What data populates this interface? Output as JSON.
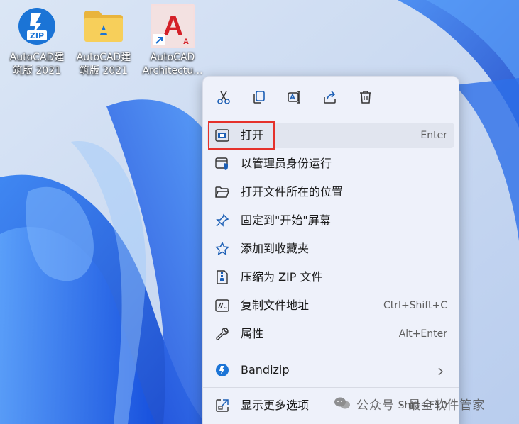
{
  "desktop": {
    "icons": [
      {
        "label_line1": "AutoCAD建",
        "label_line2": "筑版 2021",
        "icon": "zip-archive-icon",
        "badge": "ZIP"
      },
      {
        "label_line1": "AutoCAD建",
        "label_line2": "筑版 2021",
        "icon": "folder-icon"
      },
      {
        "label_line1": "AutoCAD",
        "label_line2": "Architectu...",
        "icon": "autocad-shortcut-icon",
        "logo": "A"
      }
    ]
  },
  "context_menu": {
    "quick_actions": [
      {
        "name": "cut",
        "icon": "scissors-icon"
      },
      {
        "name": "copy",
        "icon": "copy-icon"
      },
      {
        "name": "rename",
        "icon": "rename-icon"
      },
      {
        "name": "share",
        "icon": "share-icon"
      },
      {
        "name": "delete",
        "icon": "trash-icon"
      }
    ],
    "items": [
      {
        "label": "打开",
        "shortcut": "Enter",
        "icon": "open-window-icon"
      },
      {
        "label": "以管理员身份运行",
        "shortcut": "",
        "icon": "admin-shield-icon"
      },
      {
        "label": "打开文件所在的位置",
        "shortcut": "",
        "icon": "folder-open-icon"
      },
      {
        "label": "固定到\"开始\"屏幕",
        "shortcut": "",
        "icon": "pin-icon"
      },
      {
        "label": "添加到收藏夹",
        "shortcut": "",
        "icon": "star-icon"
      },
      {
        "label": "压缩为 ZIP 文件",
        "shortcut": "",
        "icon": "zip-file-icon"
      },
      {
        "label": "复制文件地址",
        "shortcut": "Ctrl+Shift+C",
        "icon": "copy-path-icon"
      },
      {
        "label": "属性",
        "shortcut": "Alt+Enter",
        "icon": "wrench-icon"
      },
      {
        "label": "Bandizip",
        "shortcut": "",
        "icon": "bandizip-icon",
        "has_submenu": true
      },
      {
        "label": "显示更多选项",
        "shortcut": "Shift+F10",
        "icon": "more-options-icon"
      }
    ]
  },
  "watermark": {
    "text": "公众号 · 最全软件管家"
  },
  "colors": {
    "accent": "#0067c0",
    "highlight": "#e5312b",
    "menu_bg": "#eef1fa"
  }
}
